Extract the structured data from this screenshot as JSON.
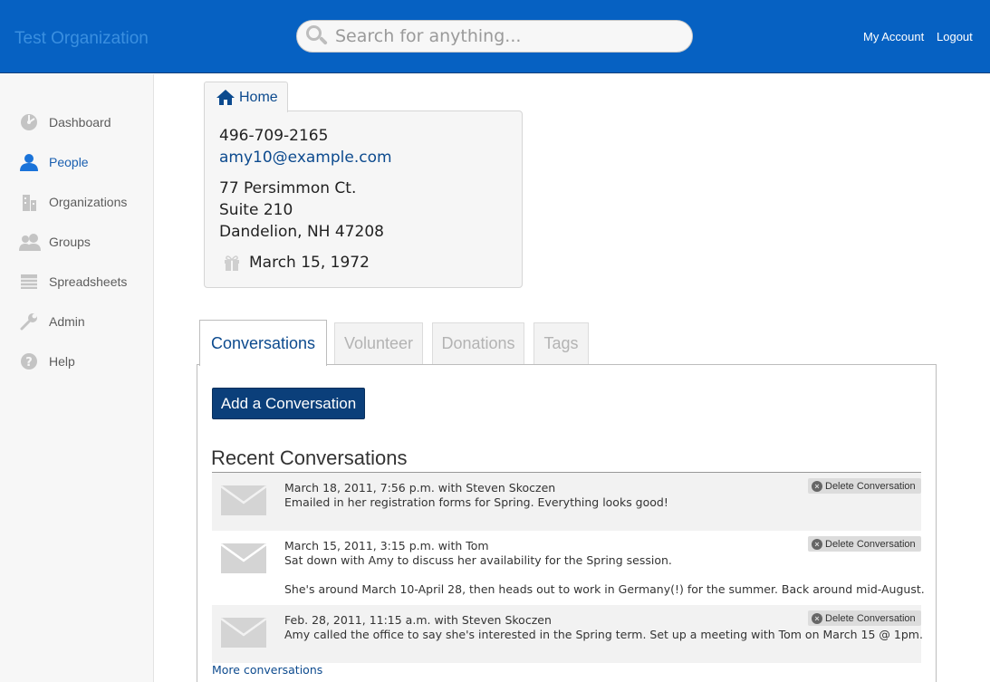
{
  "header": {
    "org_name": "Test Organization",
    "search_placeholder": "Search for anything...",
    "my_account": "My Account",
    "logout": "Logout"
  },
  "sidebar": {
    "items": [
      {
        "label": "Dashboard",
        "icon": "dashboard-icon",
        "active": false
      },
      {
        "label": "People",
        "icon": "person-icon",
        "active": true
      },
      {
        "label": "Organizations",
        "icon": "building-icon",
        "active": false
      },
      {
        "label": "Groups",
        "icon": "group-icon",
        "active": false
      },
      {
        "label": "Spreadsheets",
        "icon": "spreadsheet-icon",
        "active": false
      },
      {
        "label": "Admin",
        "icon": "wrench-icon",
        "active": false
      },
      {
        "label": "Help",
        "icon": "help-icon",
        "active": false
      }
    ]
  },
  "contact": {
    "tab_label": "Home",
    "phone": "496-709-2165",
    "email": "amy10@example.com",
    "address_line1": "77 Persimmon Ct.",
    "address_line2": "Suite 210",
    "address_line3": "Dandelion, NH 47208",
    "birthday": "March 15, 1972"
  },
  "tabs": [
    {
      "label": "Conversations",
      "active": true
    },
    {
      "label": "Volunteer",
      "active": false
    },
    {
      "label": "Donations",
      "active": false
    },
    {
      "label": "Tags",
      "active": false
    }
  ],
  "conversations": {
    "add_button": "Add a Conversation",
    "heading": "Recent Conversations",
    "delete_label": "Delete Conversation",
    "more_link": "More conversations",
    "items": [
      {
        "meta": "March 18, 2011, 7:56 p.m. with Steven Skoczen",
        "lines": [
          "Emailed in her registration forms for Spring. Everything looks good!"
        ]
      },
      {
        "meta": "March 15, 2011, 3:15 p.m. with Tom",
        "lines": [
          "Sat down with Amy to discuss her availability for the Spring session.",
          "She's around March 10-April 28, then heads out to work in Germany(!) for the summer. Back around mid-August."
        ]
      },
      {
        "meta": "Feb. 28, 2011, 11:15 a.m. with Steven Skoczen",
        "lines": [
          "Amy called the office to say she's interested in the Spring term. Set up a meeting with Tom on March 15 @ 1pm."
        ]
      }
    ]
  },
  "colors": {
    "header_bg": "#0661c2",
    "link_blue": "#0c4a8e",
    "button_navy": "#0b3f7a"
  }
}
